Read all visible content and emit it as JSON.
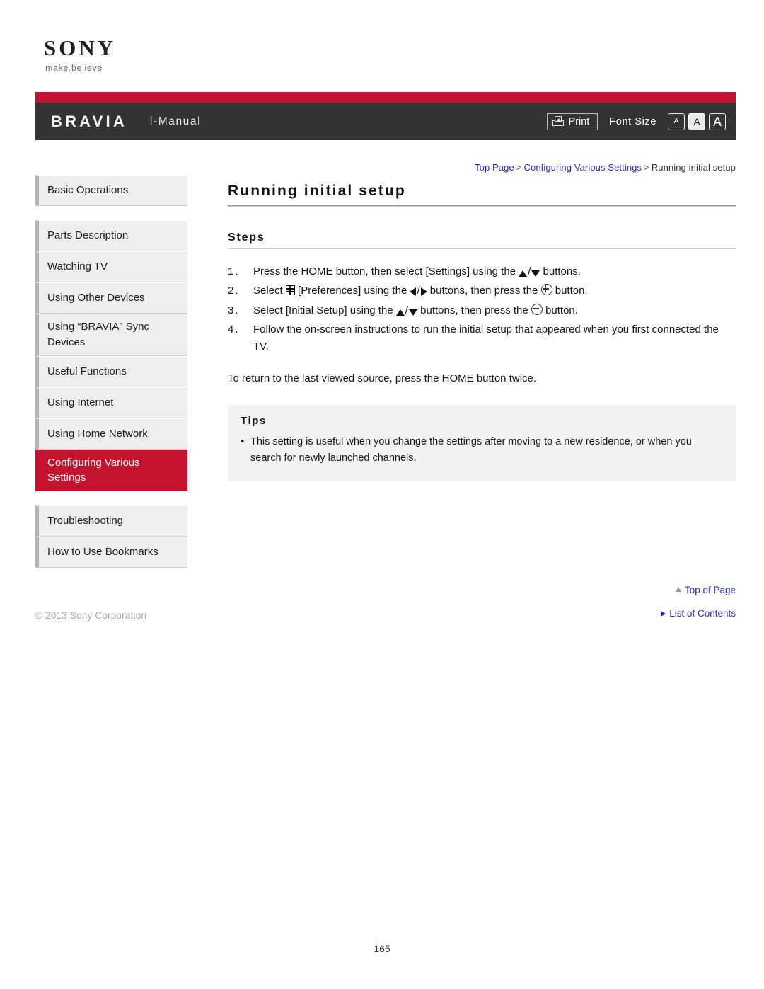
{
  "brand": {
    "logo_text": "SONY",
    "tagline": "make.believe"
  },
  "header": {
    "product": "BRAVIA",
    "manual_label": "i-Manual",
    "print_label": "Print",
    "font_size_label": "Font Size",
    "font_size_options": [
      "A",
      "A",
      "A"
    ],
    "font_size_selected_index": 1,
    "accent_color": "#c4122f",
    "bar_color": "#333333"
  },
  "breadcrumb": {
    "items": [
      {
        "label": "Top Page",
        "link": true
      },
      {
        "label": "Configuring Various Settings",
        "link": true
      },
      {
        "label": "Running initial setup",
        "link": false
      }
    ],
    "separator": ">"
  },
  "sidebar": {
    "groups": [
      {
        "items": [
          {
            "label": "Basic Operations",
            "active": false
          }
        ]
      },
      {
        "items": [
          {
            "label": "Parts Description",
            "active": false
          },
          {
            "label": "Watching TV",
            "active": false
          },
          {
            "label": "Using Other Devices",
            "active": false
          },
          {
            "label": "Using “BRAVIA” Sync Devices",
            "active": false
          },
          {
            "label": "Useful Functions",
            "active": false
          },
          {
            "label": "Using Internet",
            "active": false
          },
          {
            "label": "Using Home Network",
            "active": false
          },
          {
            "label": "Configuring Various Settings",
            "active": true
          }
        ]
      },
      {
        "items": [
          {
            "label": "Troubleshooting",
            "active": false
          },
          {
            "label": "How to Use Bookmarks",
            "active": false
          }
        ]
      }
    ],
    "active_color": "#c4122f"
  },
  "main": {
    "title": "Running initial setup",
    "steps_heading": "Steps",
    "steps": [
      {
        "number": "1.",
        "parts": [
          {
            "type": "text",
            "value": "Press the HOME button, then select [Settings] using the "
          },
          {
            "type": "icon",
            "value": "arrow-up-icon"
          },
          {
            "type": "text",
            "value": "/"
          },
          {
            "type": "icon",
            "value": "arrow-down-icon"
          },
          {
            "type": "text",
            "value": " buttons."
          }
        ]
      },
      {
        "number": "2.",
        "parts": [
          {
            "type": "text",
            "value": "Select "
          },
          {
            "type": "icon",
            "value": "preferences-icon"
          },
          {
            "type": "text",
            "value": " [Preferences] using the "
          },
          {
            "type": "icon",
            "value": "arrow-left-icon"
          },
          {
            "type": "text",
            "value": "/"
          },
          {
            "type": "icon",
            "value": "arrow-right-icon"
          },
          {
            "type": "text",
            "value": " buttons, then press the "
          },
          {
            "type": "icon",
            "value": "enter-button-icon"
          },
          {
            "type": "text",
            "value": " button."
          }
        ]
      },
      {
        "number": "3.",
        "parts": [
          {
            "type": "text",
            "value": "Select [Initial Setup] using the "
          },
          {
            "type": "icon",
            "value": "arrow-up-icon"
          },
          {
            "type": "text",
            "value": "/"
          },
          {
            "type": "icon",
            "value": "arrow-down-icon"
          },
          {
            "type": "text",
            "value": " buttons, then press the "
          },
          {
            "type": "icon",
            "value": "enter-button-icon"
          },
          {
            "type": "text",
            "value": " button."
          }
        ]
      },
      {
        "number": "4.",
        "parts": [
          {
            "type": "text",
            "value": "Follow the on-screen instructions to run the initial setup that appeared when you first connected the TV."
          }
        ]
      }
    ],
    "note": "To return to the last viewed source, press the HOME button twice.",
    "tips": {
      "heading": "Tips",
      "bullet_char": "•",
      "items": [
        "This setting is useful when you change the settings after moving to a new residence, or when you search for newly launched channels."
      ]
    }
  },
  "footer": {
    "top_of_page": "Top of Page",
    "list_of_contents": "List of Contents",
    "copyright": "© 2013 Sony Corporation",
    "page_number": "165",
    "link_color": "#2727c8"
  }
}
